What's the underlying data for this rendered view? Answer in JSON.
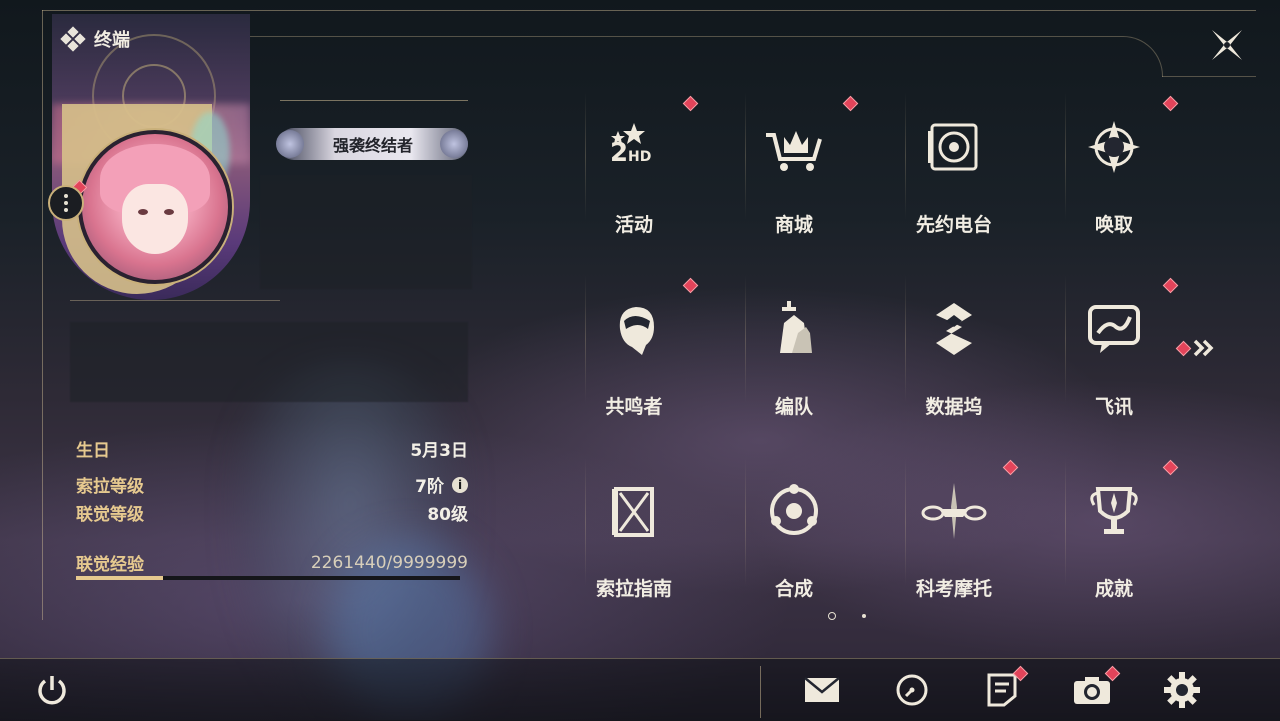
{
  "header": {
    "title": "终端",
    "close_icon": "close-icon"
  },
  "profile": {
    "title_badge": "强袭终结者",
    "stats": {
      "birthday_label": "生日",
      "birthday_value": "5月3日",
      "sora_level_label": "索拉等级",
      "sora_level_value": "7阶",
      "union_level_label": "联觉等级",
      "union_level_value": "80级",
      "union_exp_label": "联觉经验",
      "union_exp_value": "2261440/9999999",
      "union_exp_fraction": 0.2261
    }
  },
  "menu": {
    "page": 1,
    "page_count": 2,
    "items": [
      {
        "label": "活动",
        "icon": "event-2hd-icon",
        "badge": true
      },
      {
        "label": "商城",
        "icon": "shop-cart-crown-icon",
        "badge": true
      },
      {
        "label": "先约电台",
        "icon": "radio-speaker-icon",
        "badge": false
      },
      {
        "label": "唤取",
        "icon": "compass-star-icon",
        "badge": true
      },
      {
        "label": "共鸣者",
        "icon": "character-head-icon",
        "badge": true
      },
      {
        "label": "编队",
        "icon": "chess-pieces-icon",
        "badge": false
      },
      {
        "label": "数据坞",
        "icon": "data-dock-icon",
        "badge": false
      },
      {
        "label": "飞讯",
        "icon": "chat-message-icon",
        "badge": true
      },
      {
        "label": "索拉指南",
        "icon": "guide-book-icon",
        "badge": false
      },
      {
        "label": "合成",
        "icon": "synthesis-orbit-icon",
        "badge": false
      },
      {
        "label": "科考摩托",
        "icon": "motorcycle-icon",
        "badge": true
      },
      {
        "label": "成就",
        "icon": "trophy-icon",
        "badge": true
      }
    ]
  },
  "bottom_bar": {
    "buttons": [
      {
        "name": "power-icon",
        "badge": false
      },
      {
        "name": "mail-icon",
        "badge": false
      },
      {
        "name": "clock-icon",
        "badge": false
      },
      {
        "name": "notice-icon",
        "badge": true
      },
      {
        "name": "camera-icon",
        "badge": true
      },
      {
        "name": "settings-gear-icon",
        "badge": false
      }
    ]
  },
  "colors": {
    "accent_gold": "#e6c98f",
    "badge_red": "#e3445a",
    "text": "#f1ede3"
  }
}
